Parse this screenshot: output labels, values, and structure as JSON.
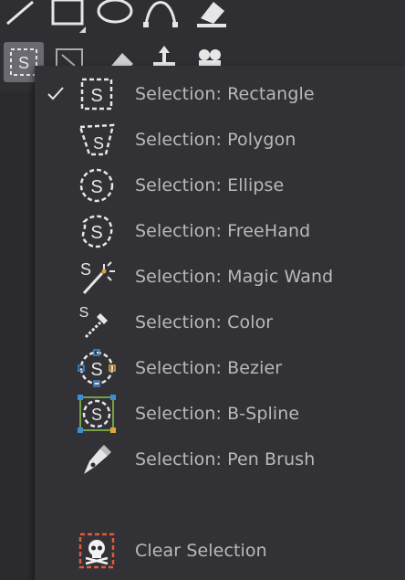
{
  "menu": {
    "items": [
      {
        "label": "Selection: Rectangle",
        "icon": "selection-rectangle-icon",
        "checked": true
      },
      {
        "label": "Selection: Polygon",
        "icon": "selection-polygon-icon",
        "checked": false
      },
      {
        "label": "Selection: Ellipse",
        "icon": "selection-ellipse-icon",
        "checked": false
      },
      {
        "label": "Selection: FreeHand",
        "icon": "selection-freehand-icon",
        "checked": false
      },
      {
        "label": "Selection: Magic Wand",
        "icon": "magic-wand-icon",
        "checked": false
      },
      {
        "label": "Selection: Color",
        "icon": "color-picker-icon",
        "checked": false
      },
      {
        "label": "Selection: Bezier",
        "icon": "selection-bezier-icon",
        "checked": false
      },
      {
        "label": "Selection: B-Spline",
        "icon": "selection-bspline-icon",
        "checked": false
      },
      {
        "label": "Selection: Pen Brush",
        "icon": "pen-brush-icon",
        "checked": false
      }
    ],
    "clear_label": "Clear Selection",
    "clear_icon": "clear-selection-skull-icon"
  },
  "colors": {
    "background": "#2b2b2e",
    "menu_bg": "#323236",
    "text": "#b9b9bd",
    "icon_stroke": "#e6e6e6",
    "bezier_orange": "#e2a43a",
    "bezier_blue": "#3a8fd8",
    "bspline_green": "#8bc34a",
    "clear_red": "#e05a3c"
  }
}
